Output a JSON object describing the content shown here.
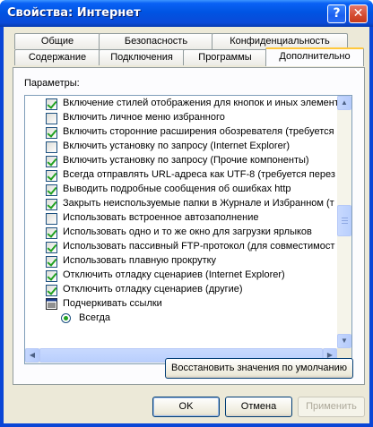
{
  "window": {
    "title": "Свойства: Интернет",
    "help_glyph": "?",
    "close_glyph": "✕"
  },
  "tabs": {
    "back_row": [
      "Общие",
      "Безопасность",
      "Конфиденциальность"
    ],
    "front_row": [
      "Содержание",
      "Подключения",
      "Программы",
      "Дополнительно"
    ],
    "active": "Дополнительно"
  },
  "panel": {
    "params_label": "Параметры:",
    "restore_button": "Восстановить значения по умолчанию"
  },
  "settings": [
    {
      "type": "checkbox",
      "checked": true,
      "label": "Включение стилей отображения для кнопок и иных элемент"
    },
    {
      "type": "checkbox",
      "checked": false,
      "label": "Включить личное меню избранного"
    },
    {
      "type": "checkbox",
      "checked": true,
      "label": "Включить сторонние расширения обозревателя (требуется"
    },
    {
      "type": "checkbox",
      "checked": false,
      "label": "Включить установку по запросу (Internet Explorer)"
    },
    {
      "type": "checkbox",
      "checked": true,
      "label": "Включить установку по запросу (Прочие компоненты)"
    },
    {
      "type": "checkbox",
      "checked": true,
      "label": "Всегда отправлять URL-адреса как UTF-8 (требуется перез"
    },
    {
      "type": "checkbox",
      "checked": true,
      "label": "Выводить подробные сообщения об ошибках http"
    },
    {
      "type": "checkbox",
      "checked": true,
      "label": "Закрыть неиспользуемые папки в Журнале и Избранном (т"
    },
    {
      "type": "checkbox",
      "checked": false,
      "label": "Использовать встроенное автозаполнение"
    },
    {
      "type": "checkbox",
      "checked": true,
      "label": "Использовать одно и то же окно для загрузки ярлыков"
    },
    {
      "type": "checkbox",
      "checked": true,
      "label": "Использовать пассивный FTP-протокол (для совместимост"
    },
    {
      "type": "checkbox",
      "checked": true,
      "label": "Использовать плавную прокрутку"
    },
    {
      "type": "checkbox",
      "checked": true,
      "label": "Отключить отладку сценариев (Internet Explorer)"
    },
    {
      "type": "checkbox",
      "checked": true,
      "label": "Отключить отладку сценариев (другие)"
    },
    {
      "type": "group",
      "label": "Подчеркивать ссылки"
    },
    {
      "type": "radio",
      "checked": true,
      "label": "Всегда"
    }
  ],
  "scrollbar": {
    "up": "▲",
    "down": "▼",
    "left": "◀",
    "right": "▶"
  },
  "buttons": {
    "ok": "OK",
    "cancel": "Отмена",
    "apply": "Применить"
  }
}
